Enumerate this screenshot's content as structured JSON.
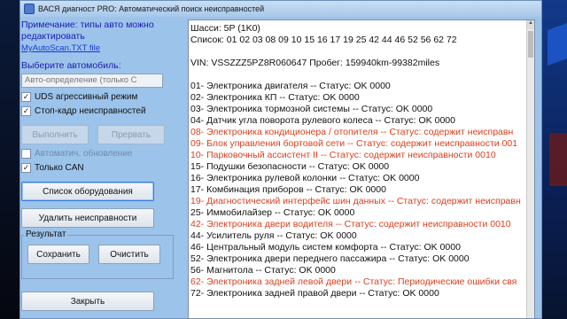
{
  "window": {
    "title": "ВАСЯ диагност PRO:  Автоматический поиск неисправностей"
  },
  "left": {
    "note": "Примечание: типы авто можно редактировать",
    "link": "MyAutoScan.TXT file",
    "choose_label": "Выберите автомобиль:",
    "select_value": "Авто-определение (только С",
    "checkbox_uds": {
      "label": "UDS агрессивный режим",
      "checked": true
    },
    "checkbox_freeze": {
      "label": "Стоп-кадр неисправностей",
      "checked": true
    },
    "btn_run": "Выполнить",
    "btn_interrupt": "Прервать",
    "checkbox_autoupdate": {
      "label": "Автоматич. обновление",
      "checked": false
    },
    "checkbox_can": {
      "label": "Только CAN",
      "checked": true
    },
    "btn_equipment": "Список оборудования",
    "btn_clear_faults": "Удалить неисправности",
    "result_group": "Результат",
    "btn_save": "Сохранить",
    "btn_clear": "Очистить",
    "btn_close": "Закрыть"
  },
  "report": {
    "chassis": "Шасси: 5P (1K0)",
    "list": "Список: 01 02 03 08 09 10 15 16 17 19 25 42 44 46 52 56 62 72",
    "vin": "VIN: VSSZZZ5PZ8R060647    Пробег: 159940km-99382miles",
    "lines": [
      {
        "text": "01- Электроника двигателя -- Статус: OK 0000",
        "fault": false
      },
      {
        "text": "02- Электроника КП -- Статус: OK 0000",
        "fault": false
      },
      {
        "text": "03- Электроника тормозной системы -- Статус: OK 0000",
        "fault": false
      },
      {
        "text": "04- Датчик угла поворота рулевого колеса -- Статус: OK 0000",
        "fault": false
      },
      {
        "text": "08- Электроника кондиционера / отопителя -- Статус: содержит неисправн",
        "fault": true
      },
      {
        "text": "09- Блок управления бортовой сети -- Статус: содержит неисправности 001",
        "fault": true
      },
      {
        "text": "10- Парковочный ассистент II -- Статус: содержит неисправности 0010",
        "fault": true
      },
      {
        "text": "15- Подушки безопасности -- Статус: OK 0000",
        "fault": false
      },
      {
        "text": "16- Электроника рулевой колонки -- Статус: OK 0000",
        "fault": false
      },
      {
        "text": "17- Комбинация приборов -- Статус: OK 0000",
        "fault": false
      },
      {
        "text": "19- Диагностический интерфейс шин данных -- Статус: содержит неисправн",
        "fault": true
      },
      {
        "text": "25- Иммобилайзер -- Статус: OK 0000",
        "fault": false
      },
      {
        "text": "42- Электроника двери водителя -- Статус: содержит неисправности 0010",
        "fault": true
      },
      {
        "text": "44- Усилитель руля -- Статус: OK 0000",
        "fault": false
      },
      {
        "text": "46- Центральный модуль систем комфорта -- Статус: OK 0000",
        "fault": false
      },
      {
        "text": "52- Электроника двери переднего пассажира -- Статус: OK 0000",
        "fault": false
      },
      {
        "text": "56- Магнитола -- Статус: OK 0000",
        "fault": false
      },
      {
        "text": "62- Электроника задней левой двери -- Статус: Периодические ошибки свя",
        "fault": true
      },
      {
        "text": "72- Электроника задней правой двери -- Статус: OK 0000",
        "fault": false
      }
    ]
  },
  "colors": {
    "window_bg": "#9cc3ea",
    "fault": "#d8411e",
    "label_blue": "#1b1bb0"
  }
}
